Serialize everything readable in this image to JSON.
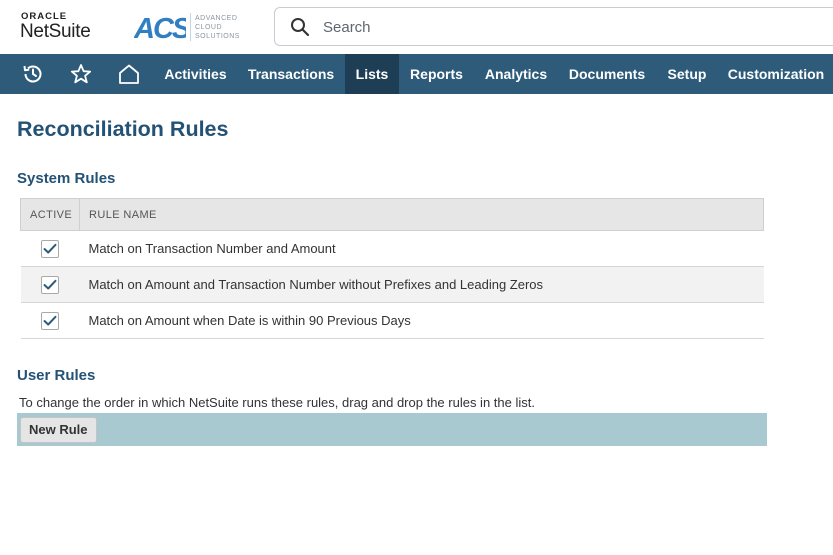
{
  "header": {
    "brand_top": "ORACLE",
    "brand_name": "NetSuite",
    "partner_mark": "ACS",
    "partner_lines": [
      "ADVANCED",
      "CLOUD",
      "SOLUTIONS"
    ],
    "search_placeholder": "Search"
  },
  "nav": {
    "icons": [
      "history-icon",
      "star-icon",
      "home-icon"
    ],
    "items": [
      "Activities",
      "Transactions",
      "Lists",
      "Reports",
      "Analytics",
      "Documents",
      "Setup",
      "Customization"
    ],
    "active": "Lists",
    "bar_color": "#2e5b7a",
    "active_color": "#1e3e55"
  },
  "page": {
    "title": "Reconciliation Rules",
    "title_color": "#245275"
  },
  "system_rules": {
    "heading": "System Rules",
    "columns": [
      "ACTIVE",
      "RULE NAME"
    ],
    "rows": [
      {
        "active": true,
        "name": "Match on Transaction Number and Amount"
      },
      {
        "active": true,
        "name": "Match on Amount and Transaction Number without Prefixes and Leading Zeros"
      },
      {
        "active": true,
        "name": "Match on Amount when Date is within 90 Previous Days"
      }
    ]
  },
  "user_rules": {
    "heading": "User Rules",
    "description": "To change the order in which NetSuite runs these rules, drag and drop the rules in the list.",
    "new_rule_label": "New Rule",
    "bar_color": "#a8c9cf"
  }
}
